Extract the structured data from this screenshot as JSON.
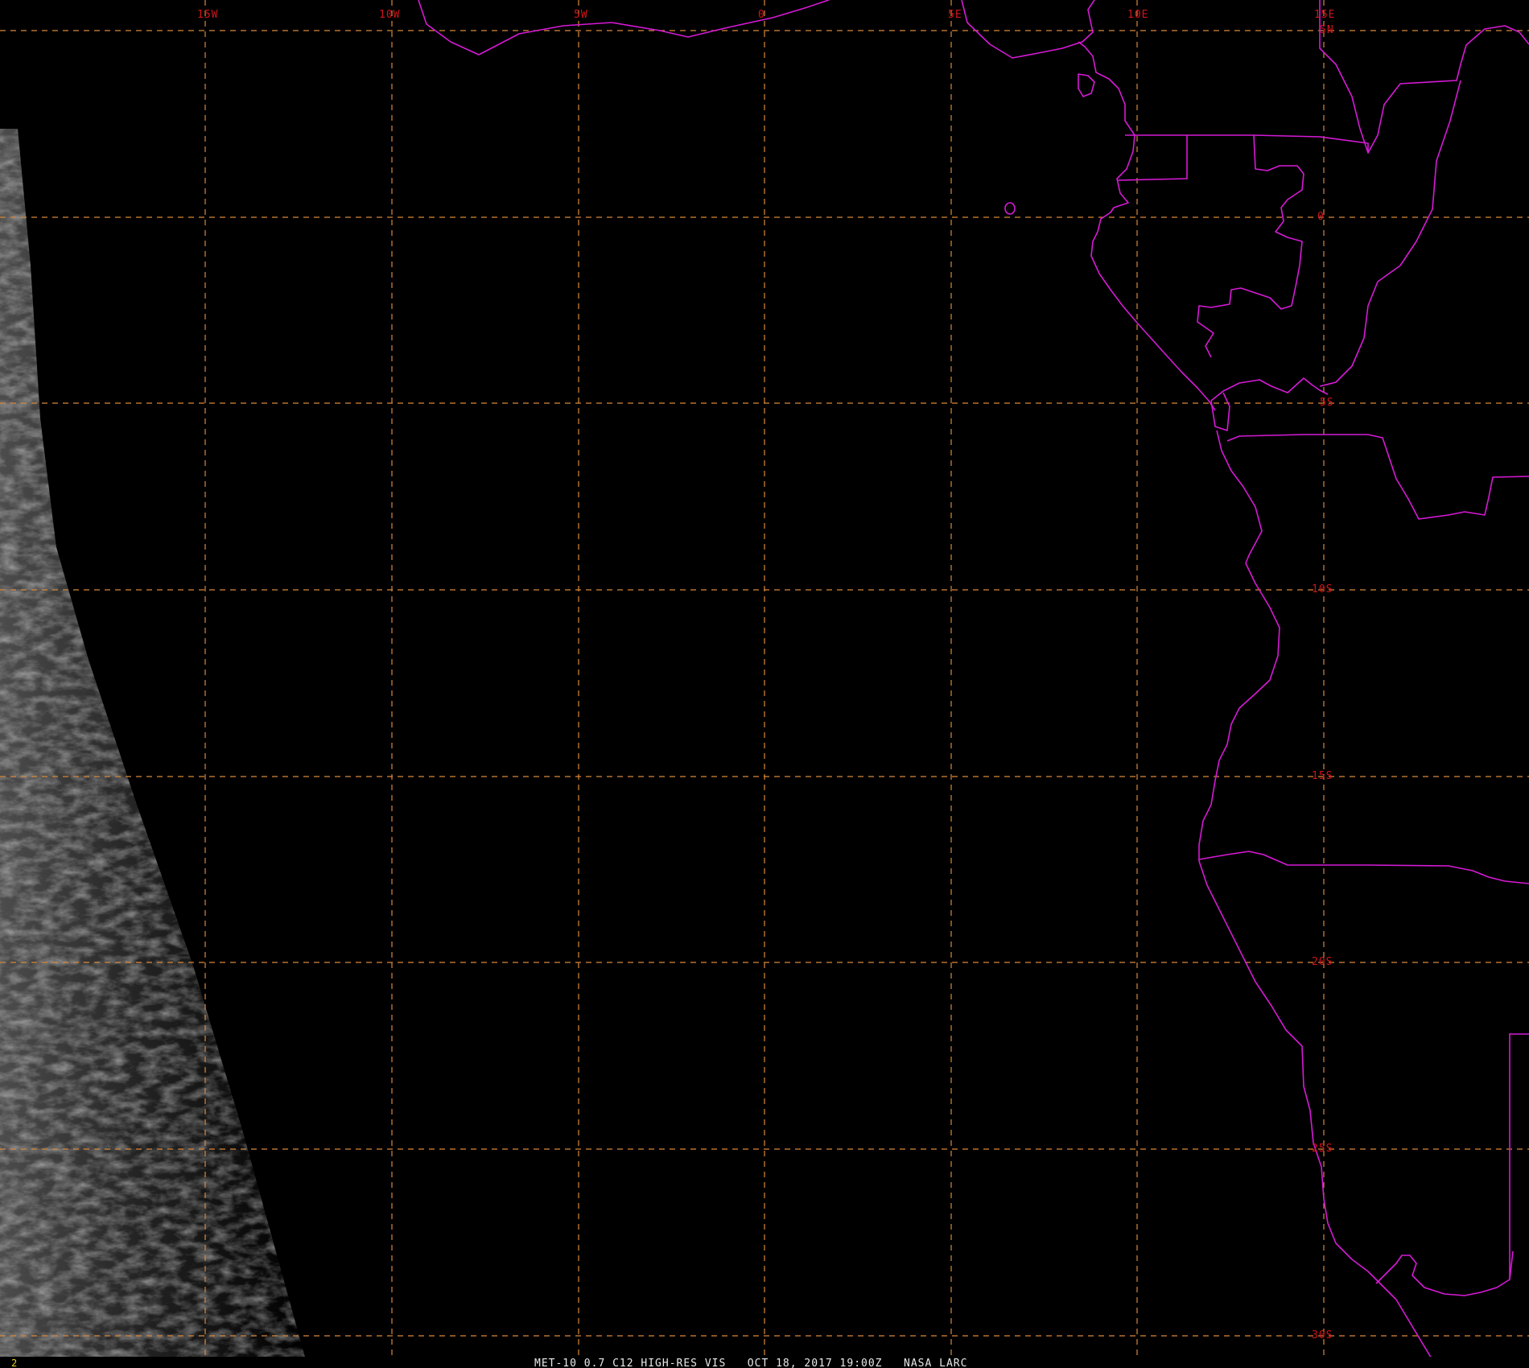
{
  "map": {
    "longitude_labels": [
      "15W",
      "10W",
      "5W",
      "0",
      "5E",
      "10E",
      "15E"
    ],
    "latitude_labels": [
      "5N",
      "0",
      "5S",
      "10S",
      "15S",
      "20S",
      "25S",
      "30S"
    ],
    "grid_style": "dashed",
    "grid_color": "#d9883a",
    "border_color": "#d61ad6",
    "label_color": "#d0141c",
    "background": "#000000",
    "imagery": "visible channel, terminator at left edge"
  },
  "footer": {
    "frame_number": "2",
    "caption": "MET-10 0.7 C12 HIGH-RES VIS   OCT 18, 2017 19:00Z   NASA LARC"
  }
}
